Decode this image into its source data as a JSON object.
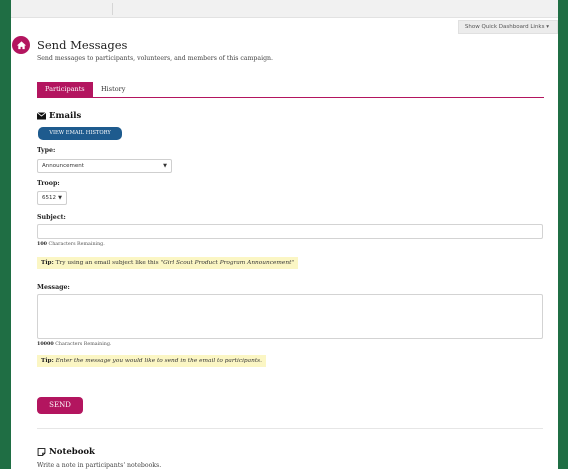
{
  "header": {
    "quick_links_label": "Show Quick Dashboard Links ▾"
  },
  "page": {
    "title": "Send Messages",
    "subtitle": "Send messages to participants, volunteers, and members of this campaign."
  },
  "tabs": [
    {
      "label": "Participants",
      "active": true
    },
    {
      "label": "History",
      "active": false
    }
  ],
  "emails": {
    "heading": "Emails",
    "view_history_label": "VIEW EMAIL HISTORY",
    "type_label": "Type:",
    "type_value": "Announcement",
    "troop_label": "Troop:",
    "troop_value": "6512",
    "subject_label": "Subject:",
    "subject_value": "",
    "subject_remaining_count": "100",
    "subject_remaining_text": "Characters Remaining.",
    "subject_tip_label": "Tip:",
    "subject_tip_text": "Try using an email subject like this",
    "subject_tip_example": "\"Girl Scout Product Program Announcement\"",
    "message_label": "Message:",
    "message_value": "",
    "message_remaining_count": "10000",
    "message_remaining_text": "Characters Remaining.",
    "message_tip_label": "Tip:",
    "message_tip_text": "Enter the message you would like to send in the email to participants.",
    "send_label": "SEND"
  },
  "notebook": {
    "heading": "Notebook",
    "description": "Write a note in participants' notebooks."
  },
  "colors": {
    "brand": "#b3155f",
    "button_blue": "#1e5b8e",
    "frame_green": "#1f6e44",
    "tip_bg": "#fbf6c4"
  }
}
